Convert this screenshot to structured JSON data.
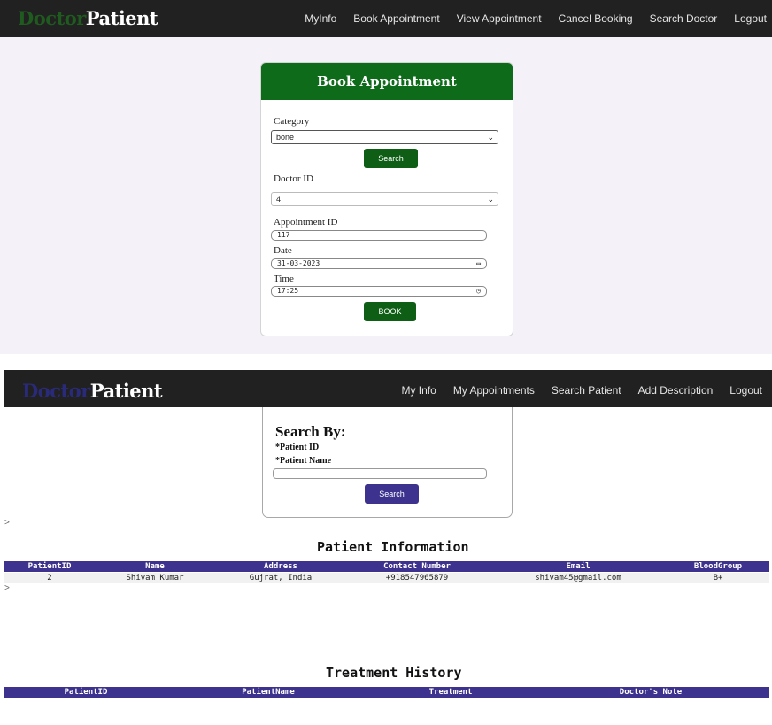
{
  "doctor_view": {
    "brand": {
      "part1": "Doctor",
      "part2": "Patient"
    },
    "nav": [
      "MyInfo",
      "Book Appointment",
      "View Appointment",
      "Cancel Booking",
      "Search Doctor",
      "Logout"
    ],
    "form": {
      "title": "Book Appointment",
      "category_label": "Category",
      "category_value": "bone",
      "search_label": "Search",
      "doctor_id_label": "Doctor ID",
      "doctor_id_value": "4",
      "appointment_id_label": "Appointment ID",
      "appointment_id_value": "117",
      "date_label": "Date",
      "date_value": "31-03-2023",
      "time_label": "Time",
      "time_value": "17:25",
      "book_label": "BOOK"
    }
  },
  "patient_view": {
    "brand": {
      "part1": "Doctor",
      "part2": "Patient"
    },
    "nav": [
      "My Info",
      "My Appointments",
      "Search Patient",
      "Add Description",
      "Logout"
    ],
    "search": {
      "title": "Search By:",
      "option1": "*Patient ID",
      "option2": "*Patient Name",
      "button": "Search"
    },
    "prompt_glyph": ">",
    "patient_info": {
      "title": "Patient Information",
      "columns": [
        "PatientID",
        "Name",
        "Address",
        "Contact Number",
        "Email",
        "BloodGroup"
      ],
      "rows": [
        [
          "2",
          "Shivam Kumar",
          "Gujrat, India",
          "+918547965879",
          "shivam45@gmail.com",
          "B+"
        ]
      ]
    },
    "treatment_history": {
      "title": "Treatment History",
      "columns": [
        "PatientID",
        "PatientName",
        "Treatment",
        "Doctor's Note"
      ]
    }
  },
  "colors": {
    "navbar": "#212121",
    "green_accent": "#0e6b1a",
    "purple_accent": "#3d338f"
  }
}
